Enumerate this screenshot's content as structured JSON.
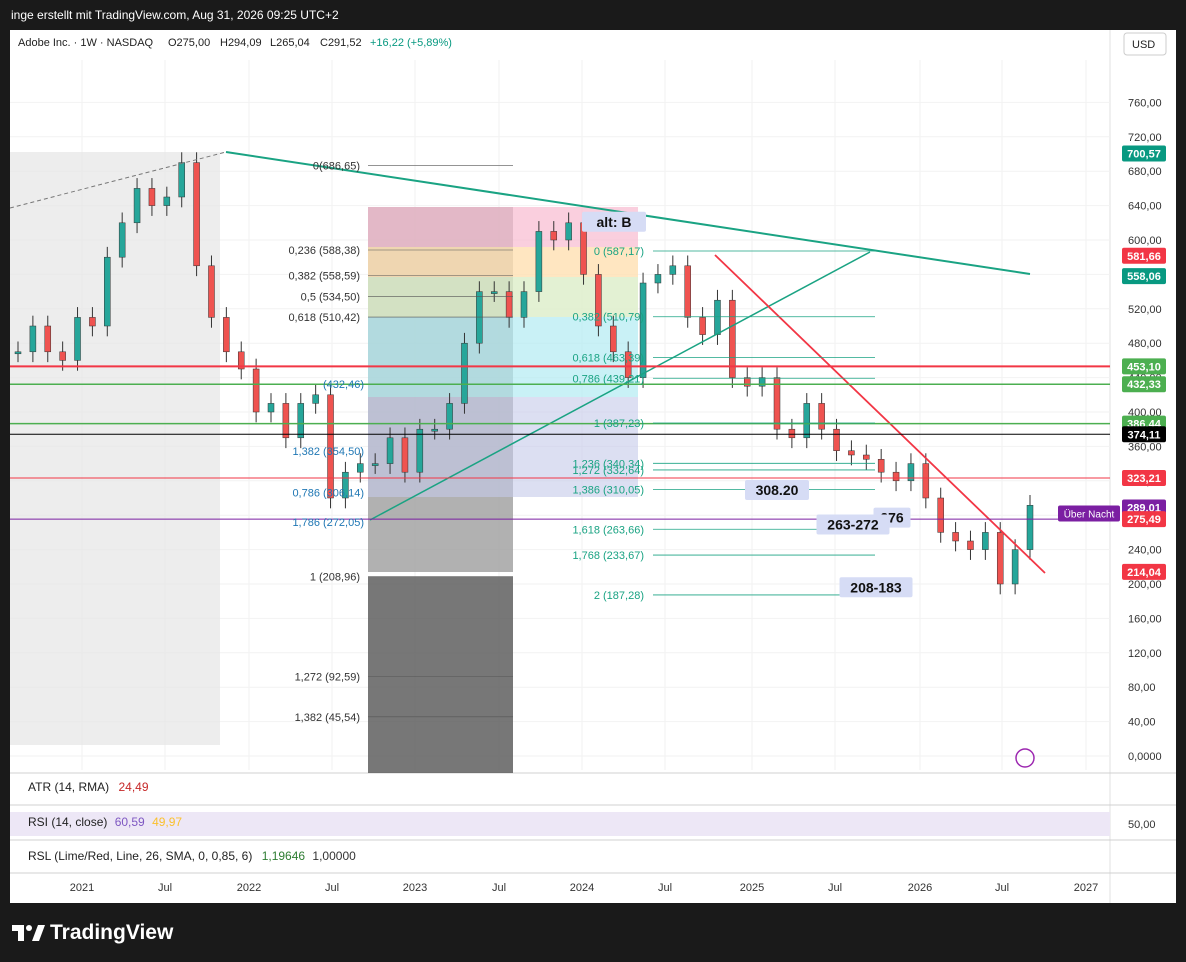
{
  "header": {
    "text": "inge erstellt mit TradingView.com, Aug 31, 2026 09:25 UTC+2"
  },
  "legend": {
    "symbol": "Adobe Inc. · 1W · NASDAQ",
    "open": "O275,00",
    "high": "H294,09",
    "low": "L265,04",
    "close": "C291,52",
    "change": "+16,22 (+5,89%)"
  },
  "currency": "USD",
  "colors": {
    "up": "#26a69a",
    "down": "#ef5350",
    "trend": "#1aa383",
    "resist": "#f23645",
    "support": "#4caf50"
  },
  "chart_data": {
    "type": "candlestick",
    "symbol": "ADBE",
    "interval": "1W",
    "ylim": [
      0,
      800
    ],
    "y_ticks": [
      "760,00",
      "720,00",
      "680,00",
      "640,00",
      "600,00",
      "560,00",
      "520,00",
      "480,00",
      "440,00",
      "400,00",
      "360,00",
      "320,00",
      "280,00",
      "240,00",
      "200,00",
      "160,00",
      "120,00",
      "80,00",
      "40,00",
      "0,0000"
    ],
    "x_ticks": [
      "2021",
      "Jul",
      "2022",
      "Jul",
      "2023",
      "Jul",
      "2024",
      "Jul",
      "2025",
      "Jul",
      "2026",
      "Jul",
      "2027"
    ],
    "series": [
      {
        "name": "Adobe weekly",
        "points": [
          [
            "2020-12",
            470
          ],
          [
            "2021-01",
            500
          ],
          [
            "2021-02",
            470
          ],
          [
            "2021-03",
            460
          ],
          [
            "2021-04",
            510
          ],
          [
            "2021-05",
            500
          ],
          [
            "2021-06",
            580
          ],
          [
            "2021-07",
            620
          ],
          [
            "2021-08",
            660
          ],
          [
            "2021-09",
            640
          ],
          [
            "2021-10",
            650
          ],
          [
            "2021-11",
            690
          ],
          [
            "2021-12",
            570
          ],
          [
            "2022-01",
            510
          ],
          [
            "2022-02",
            470
          ],
          [
            "2022-03",
            450
          ],
          [
            "2022-04",
            400
          ],
          [
            "2022-05",
            410
          ],
          [
            "2022-06",
            370
          ],
          [
            "2022-07",
            410
          ],
          [
            "2022-08",
            420
          ],
          [
            "2022-09",
            300
          ],
          [
            "2022-10",
            330
          ],
          [
            "2022-11",
            340
          ],
          [
            "2022-12",
            340
          ],
          [
            "2023-01",
            370
          ],
          [
            "2023-02",
            330
          ],
          [
            "2023-03",
            380
          ],
          [
            "2023-04",
            380
          ],
          [
            "2023-05",
            410
          ],
          [
            "2023-06",
            480
          ],
          [
            "2023-07",
            540
          ],
          [
            "2023-08",
            540
          ],
          [
            "2023-09",
            510
          ],
          [
            "2023-10",
            540
          ],
          [
            "2023-11",
            610
          ],
          [
            "2023-12",
            600
          ],
          [
            "2024-01",
            620
          ],
          [
            "2024-02",
            560
          ],
          [
            "2024-03",
            500
          ],
          [
            "2024-04",
            470
          ],
          [
            "2024-05",
            440
          ],
          [
            "2024-06",
            550
          ],
          [
            "2024-07",
            560
          ],
          [
            "2024-08",
            570
          ],
          [
            "2024-09",
            510
          ],
          [
            "2024-10",
            490
          ],
          [
            "2024-11",
            530
          ],
          [
            "2024-12",
            440
          ],
          [
            "2025-01",
            430
          ],
          [
            "2025-02",
            440
          ],
          [
            "2025-03",
            380
          ],
          [
            "2025-04",
            370
          ],
          [
            "2025-05",
            410
          ],
          [
            "2025-06",
            380
          ],
          [
            "2025-07",
            355
          ],
          [
            "2025-08",
            350
          ],
          [
            "2025-09",
            345
          ],
          [
            "2025-10",
            330
          ],
          [
            "2025-11",
            320
          ],
          [
            "2025-12",
            340
          ],
          [
            "2026-01",
            300
          ],
          [
            "2026-02",
            260
          ],
          [
            "2026-03",
            250
          ],
          [
            "2026-04",
            240
          ],
          [
            "2026-05",
            260
          ],
          [
            "2026-06",
            200
          ],
          [
            "2026-07",
            240
          ],
          [
            "2026-08",
            291.52
          ]
        ]
      }
    ],
    "price_labels": [
      {
        "value": 700.57,
        "text": "700,57",
        "color": "#089981"
      },
      {
        "value": 581.66,
        "text": "581,66",
        "color": "#f23645"
      },
      {
        "value": 558.06,
        "text": "558,06",
        "color": "#089981"
      },
      {
        "value": 453.1,
        "text": "453,10",
        "color": "#4caf50"
      },
      {
        "value": 432.33,
        "text": "432,33",
        "color": "#4caf50"
      },
      {
        "value": 386.44,
        "text": "386,44",
        "color": "#4caf50"
      },
      {
        "value": 374.11,
        "text": "374,11",
        "color": "#000000"
      },
      {
        "value": 323.21,
        "text": "323,21",
        "color": "#f23645"
      },
      {
        "value": 289.01,
        "text": "289,01",
        "color": "#7b1fa2"
      },
      {
        "value": 275.49,
        "text": "275,49",
        "color": "#f23645"
      },
      {
        "value": 214.04,
        "text": "214,04",
        "color": "#f23645"
      }
    ],
    "after_hours_label": "Über Nacht",
    "annotations": [
      {
        "text": "alt: B",
        "value": 620
      },
      {
        "text": "308.20",
        "value": 308.2
      },
      {
        "text": "276",
        "value": 276
      },
      {
        "text": "263-272",
        "value": 268
      },
      {
        "text": "208-183",
        "value": 195
      }
    ],
    "fib_left": [
      {
        "text": "0(686,65)",
        "value": 686.65
      },
      {
        "text": "0,236 (588,38)",
        "value": 588.38
      },
      {
        "text": "0,382 (558,59)",
        "value": 558.59
      },
      {
        "text": "0,5 (534,50)",
        "value": 534.5
      },
      {
        "text": "0,618 (510,42)",
        "value": 510.42
      },
      {
        "text": "1 (208,96)",
        "value": 208.96
      },
      {
        "text": "1,272 (92,59)",
        "value": 92.59
      },
      {
        "text": "1,382 (45,54)",
        "value": 45.54
      }
    ],
    "fib_mid": [
      {
        "text": "(432,46)",
        "value": 432.46
      },
      {
        "text": "1,382 (354,50)",
        "value": 354.5
      },
      {
        "text": "1,786 (272,05)",
        "value": 272.05
      },
      {
        "text": "0,786 (306,14)",
        "value": 306.14
      }
    ],
    "fib_right": [
      {
        "text": "0 (587,17)",
        "value": 587.17
      },
      {
        "text": "0,382 (510,79)",
        "value": 510.79
      },
      {
        "text": "0,618 (463,39)",
        "value": 463.39
      },
      {
        "text": "0,786 (439,21)",
        "value": 439.21
      },
      {
        "text": "1 (387,23)",
        "value": 387.23
      },
      {
        "text": "1,236 (340,34)",
        "value": 340.34
      },
      {
        "text": "1,272 (332,64)",
        "value": 332.64
      },
      {
        "text": "1,386 (310,05)",
        "value": 310.05
      },
      {
        "text": "1,618 (263,66)",
        "value": 263.66
      },
      {
        "text": "1,768 (233,67)",
        "value": 233.67
      },
      {
        "text": "2 (187,28)",
        "value": 187.28
      }
    ]
  },
  "indicators": {
    "atr": {
      "label": "ATR (14, RMA)",
      "value": "24,49"
    },
    "rsi": {
      "label": "RSI (14, close)",
      "value": "60,59",
      "value2": "49,97",
      "scale": "50,00"
    },
    "rsl": {
      "label": "RSL (Lime/Red, Line, 26, SMA, 0, 0,85, 6)",
      "value": "1,19646",
      "value2": "1,00000"
    }
  },
  "footer": {
    "brand": "TradingView"
  }
}
